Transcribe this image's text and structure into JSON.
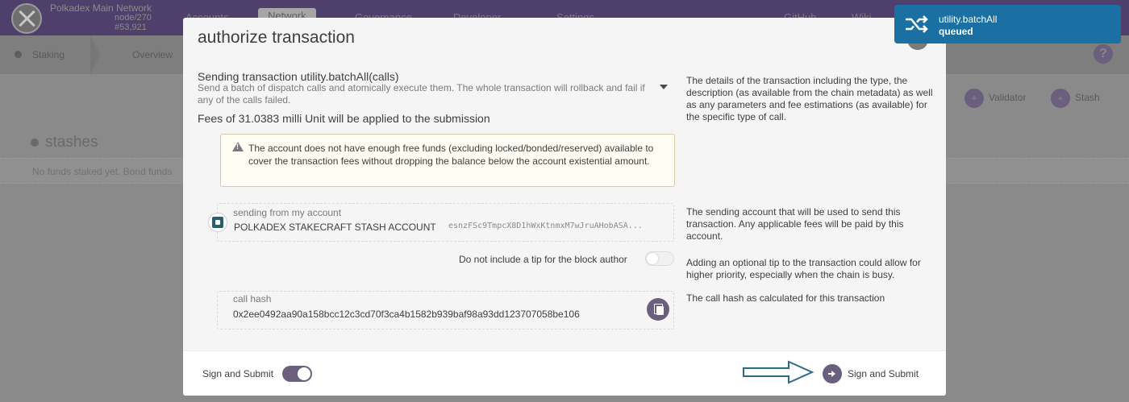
{
  "app": {
    "chain_name": "Polkadex Main Network",
    "node": "node/270",
    "block": "#53,921",
    "nav": [
      "Accounts",
      "Network",
      "Governance",
      "Developer",
      "Settings",
      "GitHub",
      "Wiki"
    ],
    "subnav": [
      "Staking",
      "Overview"
    ],
    "actions": [
      "Validator",
      "Stash"
    ],
    "stashes_title": "stashes",
    "no_funds_text": "No funds staked yet. Bond funds",
    "help_icon": "?"
  },
  "toast": {
    "icon": "shuffle-icon",
    "method": "utility.batchAll",
    "status": "queued",
    "color": "#1a6fa3"
  },
  "modal": {
    "title": "authorize transaction",
    "tx_title": "Sending transaction utility.batchAll(calls)",
    "tx_description": "Send a batch of dispatch calls and atomically execute them. The whole transaction will rollback and fail if any of the calls failed.",
    "fees": "Fees of 31.0383 milli Unit will be applied to the submission",
    "warning": "The account does not have enough free funds (excluding locked/bonded/reserved) available to cover the transaction fees without dropping the balance below the account existential amount.",
    "hints": {
      "details": "The details of the transaction including the type, the description (as available from the chain metadata) as well as any parameters and fee estimations (as available) for the specific type of call.",
      "sender": "The sending account that will be used to send this transaction. Any applicable fees will be paid by this account.",
      "tip": "Adding an optional tip to the transaction could allow for higher priority, especially when the chain is busy.",
      "hash": "The call hash as calculated for this transaction"
    },
    "account": {
      "label": "sending from my account",
      "name": "POLKADEX STAKECRAFT STASH ACCOUNT",
      "address": "esnzFSc9TmpcX8D1hWxKtnmxM7wJruAHobASA..."
    },
    "tip_label": "Do not include a tip for the block author",
    "tip_enabled": false,
    "call_hash": {
      "label": "call hash",
      "value": "0x2ee0492aa90a158bcc12c3cd70f3ca4b1582b939baf98a93dd123707058be106"
    },
    "footer": {
      "toggle_label": "Sign and Submit",
      "toggle_on": true,
      "submit_label": "Sign and Submit"
    },
    "accent_color": "#6a5f7c"
  }
}
